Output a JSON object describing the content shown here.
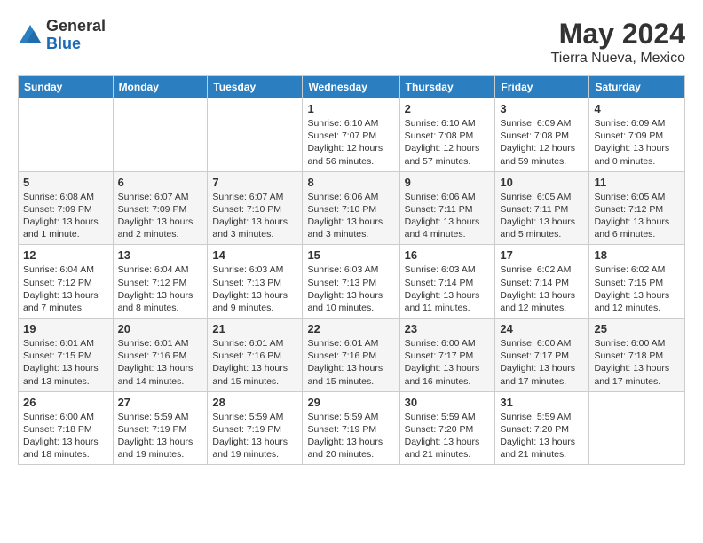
{
  "logo": {
    "general": "General",
    "blue": "Blue"
  },
  "title": "May 2024",
  "subtitle": "Tierra Nueva, Mexico",
  "days_of_week": [
    "Sunday",
    "Monday",
    "Tuesday",
    "Wednesday",
    "Thursday",
    "Friday",
    "Saturday"
  ],
  "weeks": [
    [
      {
        "day": "",
        "info": ""
      },
      {
        "day": "",
        "info": ""
      },
      {
        "day": "",
        "info": ""
      },
      {
        "day": "1",
        "info": "Sunrise: 6:10 AM\nSunset: 7:07 PM\nDaylight: 12 hours and 56 minutes."
      },
      {
        "day": "2",
        "info": "Sunrise: 6:10 AM\nSunset: 7:08 PM\nDaylight: 12 hours and 57 minutes."
      },
      {
        "day": "3",
        "info": "Sunrise: 6:09 AM\nSunset: 7:08 PM\nDaylight: 12 hours and 59 minutes."
      },
      {
        "day": "4",
        "info": "Sunrise: 6:09 AM\nSunset: 7:09 PM\nDaylight: 13 hours and 0 minutes."
      }
    ],
    [
      {
        "day": "5",
        "info": "Sunrise: 6:08 AM\nSunset: 7:09 PM\nDaylight: 13 hours and 1 minute."
      },
      {
        "day": "6",
        "info": "Sunrise: 6:07 AM\nSunset: 7:09 PM\nDaylight: 13 hours and 2 minutes."
      },
      {
        "day": "7",
        "info": "Sunrise: 6:07 AM\nSunset: 7:10 PM\nDaylight: 13 hours and 3 minutes."
      },
      {
        "day": "8",
        "info": "Sunrise: 6:06 AM\nSunset: 7:10 PM\nDaylight: 13 hours and 3 minutes."
      },
      {
        "day": "9",
        "info": "Sunrise: 6:06 AM\nSunset: 7:11 PM\nDaylight: 13 hours and 4 minutes."
      },
      {
        "day": "10",
        "info": "Sunrise: 6:05 AM\nSunset: 7:11 PM\nDaylight: 13 hours and 5 minutes."
      },
      {
        "day": "11",
        "info": "Sunrise: 6:05 AM\nSunset: 7:12 PM\nDaylight: 13 hours and 6 minutes."
      }
    ],
    [
      {
        "day": "12",
        "info": "Sunrise: 6:04 AM\nSunset: 7:12 PM\nDaylight: 13 hours and 7 minutes."
      },
      {
        "day": "13",
        "info": "Sunrise: 6:04 AM\nSunset: 7:12 PM\nDaylight: 13 hours and 8 minutes."
      },
      {
        "day": "14",
        "info": "Sunrise: 6:03 AM\nSunset: 7:13 PM\nDaylight: 13 hours and 9 minutes."
      },
      {
        "day": "15",
        "info": "Sunrise: 6:03 AM\nSunset: 7:13 PM\nDaylight: 13 hours and 10 minutes."
      },
      {
        "day": "16",
        "info": "Sunrise: 6:03 AM\nSunset: 7:14 PM\nDaylight: 13 hours and 11 minutes."
      },
      {
        "day": "17",
        "info": "Sunrise: 6:02 AM\nSunset: 7:14 PM\nDaylight: 13 hours and 12 minutes."
      },
      {
        "day": "18",
        "info": "Sunrise: 6:02 AM\nSunset: 7:15 PM\nDaylight: 13 hours and 12 minutes."
      }
    ],
    [
      {
        "day": "19",
        "info": "Sunrise: 6:01 AM\nSunset: 7:15 PM\nDaylight: 13 hours and 13 minutes."
      },
      {
        "day": "20",
        "info": "Sunrise: 6:01 AM\nSunset: 7:16 PM\nDaylight: 13 hours and 14 minutes."
      },
      {
        "day": "21",
        "info": "Sunrise: 6:01 AM\nSunset: 7:16 PM\nDaylight: 13 hours and 15 minutes."
      },
      {
        "day": "22",
        "info": "Sunrise: 6:01 AM\nSunset: 7:16 PM\nDaylight: 13 hours and 15 minutes."
      },
      {
        "day": "23",
        "info": "Sunrise: 6:00 AM\nSunset: 7:17 PM\nDaylight: 13 hours and 16 minutes."
      },
      {
        "day": "24",
        "info": "Sunrise: 6:00 AM\nSunset: 7:17 PM\nDaylight: 13 hours and 17 minutes."
      },
      {
        "day": "25",
        "info": "Sunrise: 6:00 AM\nSunset: 7:18 PM\nDaylight: 13 hours and 17 minutes."
      }
    ],
    [
      {
        "day": "26",
        "info": "Sunrise: 6:00 AM\nSunset: 7:18 PM\nDaylight: 13 hours and 18 minutes."
      },
      {
        "day": "27",
        "info": "Sunrise: 5:59 AM\nSunset: 7:19 PM\nDaylight: 13 hours and 19 minutes."
      },
      {
        "day": "28",
        "info": "Sunrise: 5:59 AM\nSunset: 7:19 PM\nDaylight: 13 hours and 19 minutes."
      },
      {
        "day": "29",
        "info": "Sunrise: 5:59 AM\nSunset: 7:19 PM\nDaylight: 13 hours and 20 minutes."
      },
      {
        "day": "30",
        "info": "Sunrise: 5:59 AM\nSunset: 7:20 PM\nDaylight: 13 hours and 21 minutes."
      },
      {
        "day": "31",
        "info": "Sunrise: 5:59 AM\nSunset: 7:20 PM\nDaylight: 13 hours and 21 minutes."
      },
      {
        "day": "",
        "info": ""
      }
    ]
  ]
}
